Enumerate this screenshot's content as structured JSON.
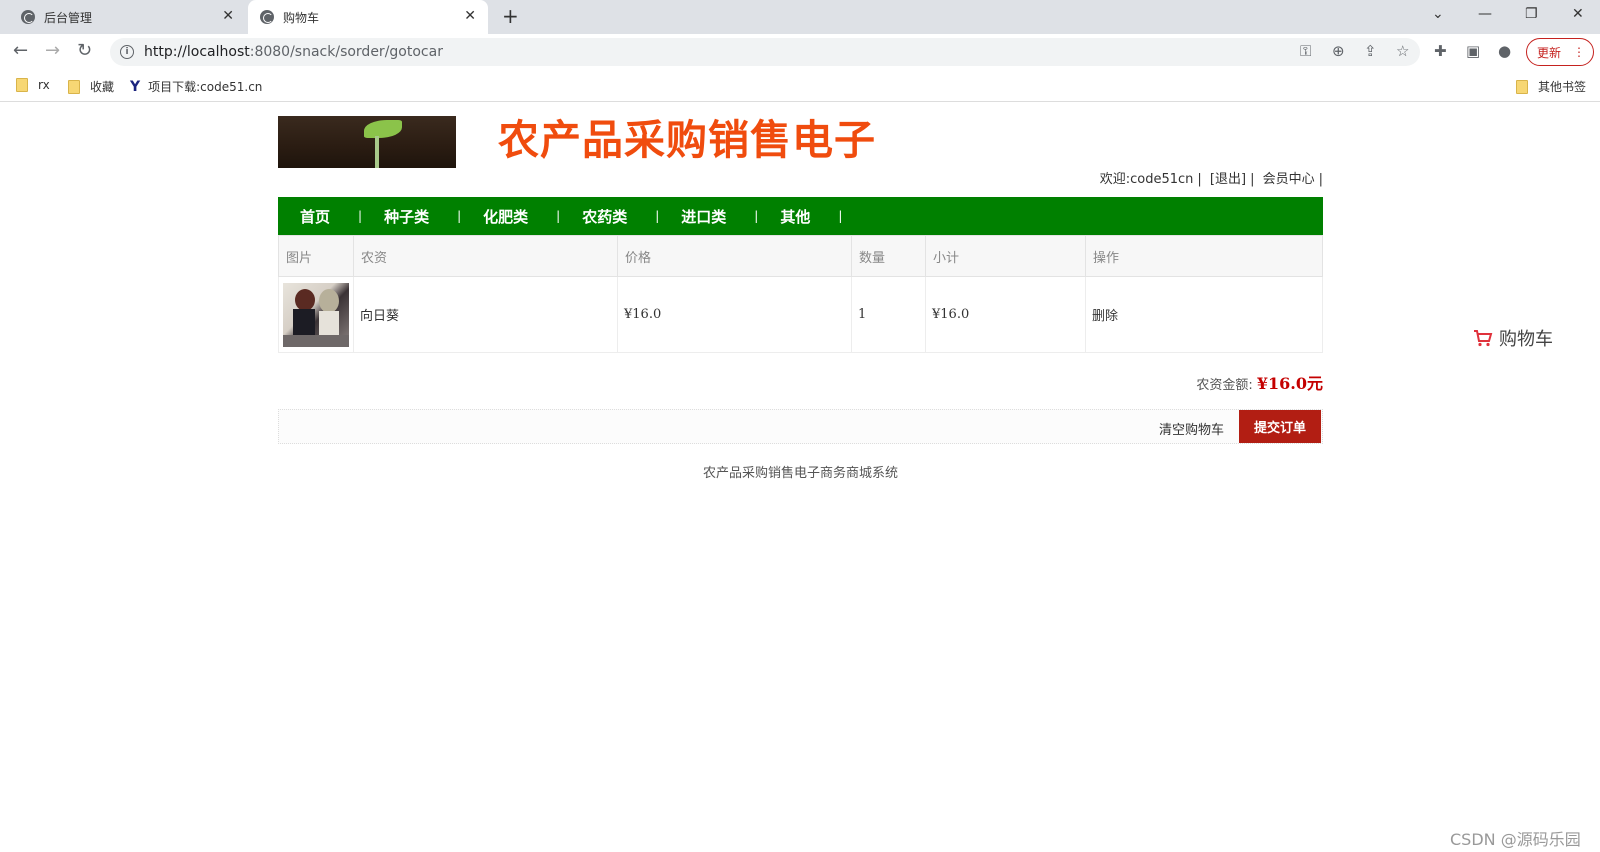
{
  "browser": {
    "tabs": [
      {
        "title": "后台管理"
      },
      {
        "title": "购物车"
      }
    ],
    "url_host": "http://localhost",
    "url_path": ":8080/snack/sorder/gotocar",
    "update_label": "更新",
    "bookmarks": [
      "rx",
      "收藏",
      "项目下载:code51.cn"
    ],
    "other_bookmarks": "其他书签"
  },
  "site": {
    "title": "农产品采购销售电子",
    "welcome": "欢迎:code51cn",
    "logout": "[退出]",
    "member_center": "会员中心"
  },
  "nav": {
    "items": [
      "首页",
      "种子类",
      "化肥类",
      "农药类",
      "进口类",
      "其他"
    ]
  },
  "cart": {
    "headers": [
      "图片",
      "农资",
      "价格",
      "数量",
      "小计",
      "操作"
    ],
    "rows": [
      {
        "name": "向日葵",
        "price": "¥16.0",
        "qty": "1",
        "subtotal": "¥16.0",
        "action": "删除"
      }
    ],
    "total_label": "农资金额:",
    "total_value": "¥16.0元",
    "clear_label": "清空购物车",
    "submit_label": "提交订单"
  },
  "footer": "农产品采购销售电子商务商城系统",
  "float_cart": "购物车",
  "watermark": "CSDN @源码乐园",
  "colors": {
    "nav_bg": "#008000",
    "title": "#f04c0e",
    "submit": "#b21e13",
    "total": "#c40000"
  }
}
